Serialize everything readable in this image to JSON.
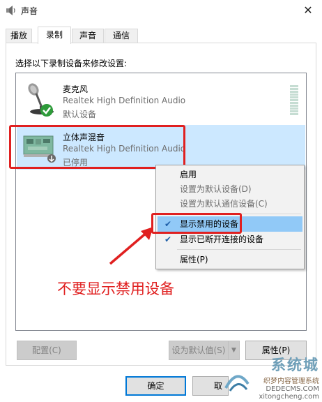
{
  "window": {
    "title": "声音",
    "close_glyph": "✕"
  },
  "tabs": [
    {
      "label": "播放",
      "active": false
    },
    {
      "label": "录制",
      "active": true
    },
    {
      "label": "声音",
      "active": false
    },
    {
      "label": "通信",
      "active": false
    }
  ],
  "instruction": "选择以下录制设备来修改设置:",
  "devices": [
    {
      "name": "麦克风",
      "driver": "Realtek High Definition Audio",
      "status": "默认设备",
      "icon": "microphone-icon",
      "badge": "green-check",
      "selected": false
    },
    {
      "name": "立体声混音",
      "driver": "Realtek High Definition Audio",
      "status": "已停用",
      "icon": "sound-card-icon",
      "badge": "disabled-down-arrow",
      "selected": true
    }
  ],
  "context_menu": {
    "items": [
      {
        "label": "启用",
        "disabled": false,
        "checked": false,
        "highlighted": false
      },
      {
        "label": "设置为默认设备(D)",
        "disabled": true,
        "checked": false,
        "highlighted": false
      },
      {
        "label": "设置为默认通信设备(C)",
        "disabled": true,
        "checked": false,
        "highlighted": false
      },
      {
        "label": "显示禁用的设备",
        "disabled": false,
        "checked": true,
        "highlighted": true
      },
      {
        "label": "显示已断开连接的设备",
        "disabled": false,
        "checked": true,
        "highlighted": false
      },
      {
        "label": "属性(P)",
        "disabled": false,
        "checked": false,
        "highlighted": false
      }
    ]
  },
  "annotation": {
    "text": "不要显示禁用设备",
    "color": "#e02020"
  },
  "buttons": {
    "configure": "配置(C)",
    "set_default": "设为默认值(S)",
    "properties": "属性(P)",
    "ok": "确定",
    "cancel": "取"
  },
  "watermark": {
    "brand": "系统城",
    "site_name": "织梦内容管理系统",
    "url_1": "DEDECMS.COM",
    "url_2": "xitongcheng.com"
  },
  "colors": {
    "accent": "#0078d7",
    "selection": "#cce8ff",
    "menu_highlight": "#91c9f7",
    "annotation_red": "#e02020"
  }
}
